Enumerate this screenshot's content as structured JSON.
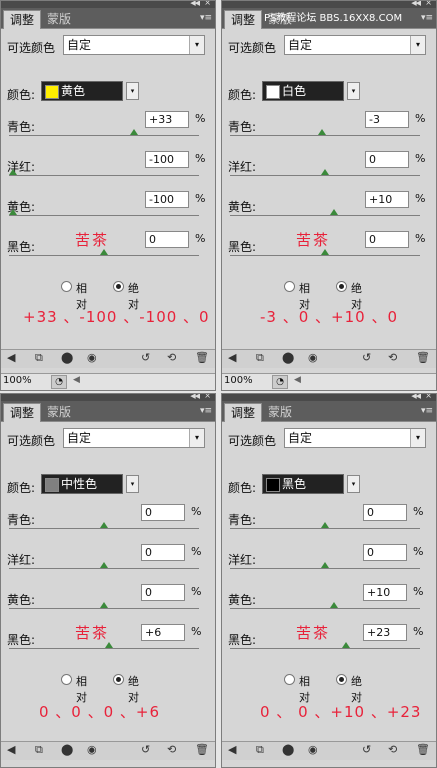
{
  "watermark": "PS教程论坛 BBS.16XX8.COM",
  "panels": [
    {
      "tab_active": "调整",
      "tab_inactive": "蒙版",
      "preset_label": "可选颜色",
      "preset_value": "自定",
      "color_label": "颜色:",
      "color_name": "黄色",
      "swatch": "#ffee00",
      "sliders": [
        {
          "label": "青色:",
          "value": "+33",
          "pct": "%",
          "level": 0.665
        },
        {
          "label": "洋红:",
          "value": "-100",
          "pct": "%",
          "level": 0.0
        },
        {
          "label": "黄色:",
          "value": "-100",
          "pct": "%",
          "level": 0.0
        },
        {
          "label": "黑色:",
          "value": "0",
          "pct": "%",
          "level": 0.5
        }
      ],
      "annotation": "苦茶",
      "radio_relative": "相对",
      "radio_absolute": "绝对",
      "values_line": "+33 、-100 、-100 、0",
      "zoom": "100%"
    },
    {
      "tab_active": "调整",
      "tab_inactive": "蒙版",
      "preset_label": "可选颜色",
      "preset_value": "自定",
      "color_label": "颜色:",
      "color_name": "白色",
      "swatch": "#ffffff",
      "sliders": [
        {
          "label": "青色:",
          "value": "-3",
          "pct": "%",
          "level": 0.485
        },
        {
          "label": "洋红:",
          "value": "0",
          "pct": "%",
          "level": 0.5
        },
        {
          "label": "黄色:",
          "value": "+10",
          "pct": "%",
          "level": 0.55
        },
        {
          "label": "黑色:",
          "value": "0",
          "pct": "%",
          "level": 0.5
        }
      ],
      "annotation": "苦茶",
      "radio_relative": "相对",
      "radio_absolute": "绝对",
      "values_line": "-3 、0 、+10 、0",
      "zoom": "100%"
    },
    {
      "tab_active": "调整",
      "tab_inactive": "蒙版",
      "preset_label": "可选颜色",
      "preset_value": "自定",
      "color_label": "颜色:",
      "color_name": "中性色",
      "swatch": "#808080",
      "sliders": [
        {
          "label": "青色:",
          "value": "0",
          "pct": "%",
          "level": 0.5
        },
        {
          "label": "洋红:",
          "value": "0",
          "pct": "%",
          "level": 0.5
        },
        {
          "label": "黄色:",
          "value": "0",
          "pct": "%",
          "level": 0.5
        },
        {
          "label": "黑色:",
          "value": "+6",
          "pct": "%",
          "level": 0.53
        }
      ],
      "annotation": "苦茶",
      "radio_relative": "相对",
      "radio_absolute": "绝对",
      "values_line": "0 、0 、0 、+6",
      "zoom": ""
    },
    {
      "tab_active": "调整",
      "tab_inactive": "蒙版",
      "preset_label": "可选颜色",
      "preset_value": "自定",
      "color_label": "颜色:",
      "color_name": "黑色",
      "swatch": "#000000",
      "sliders": [
        {
          "label": "青色:",
          "value": "0",
          "pct": "%",
          "level": 0.5
        },
        {
          "label": "洋红:",
          "value": "0",
          "pct": "%",
          "level": 0.5
        },
        {
          "label": "黄色:",
          "value": "+10",
          "pct": "%",
          "level": 0.55
        },
        {
          "label": "黑色:",
          "value": "+23",
          "pct": "%",
          "level": 0.615
        }
      ],
      "annotation": "苦茶",
      "radio_relative": "相对",
      "radio_absolute": "绝对",
      "values_line": "0 、 0 、+10 、+23",
      "zoom": ""
    }
  ]
}
